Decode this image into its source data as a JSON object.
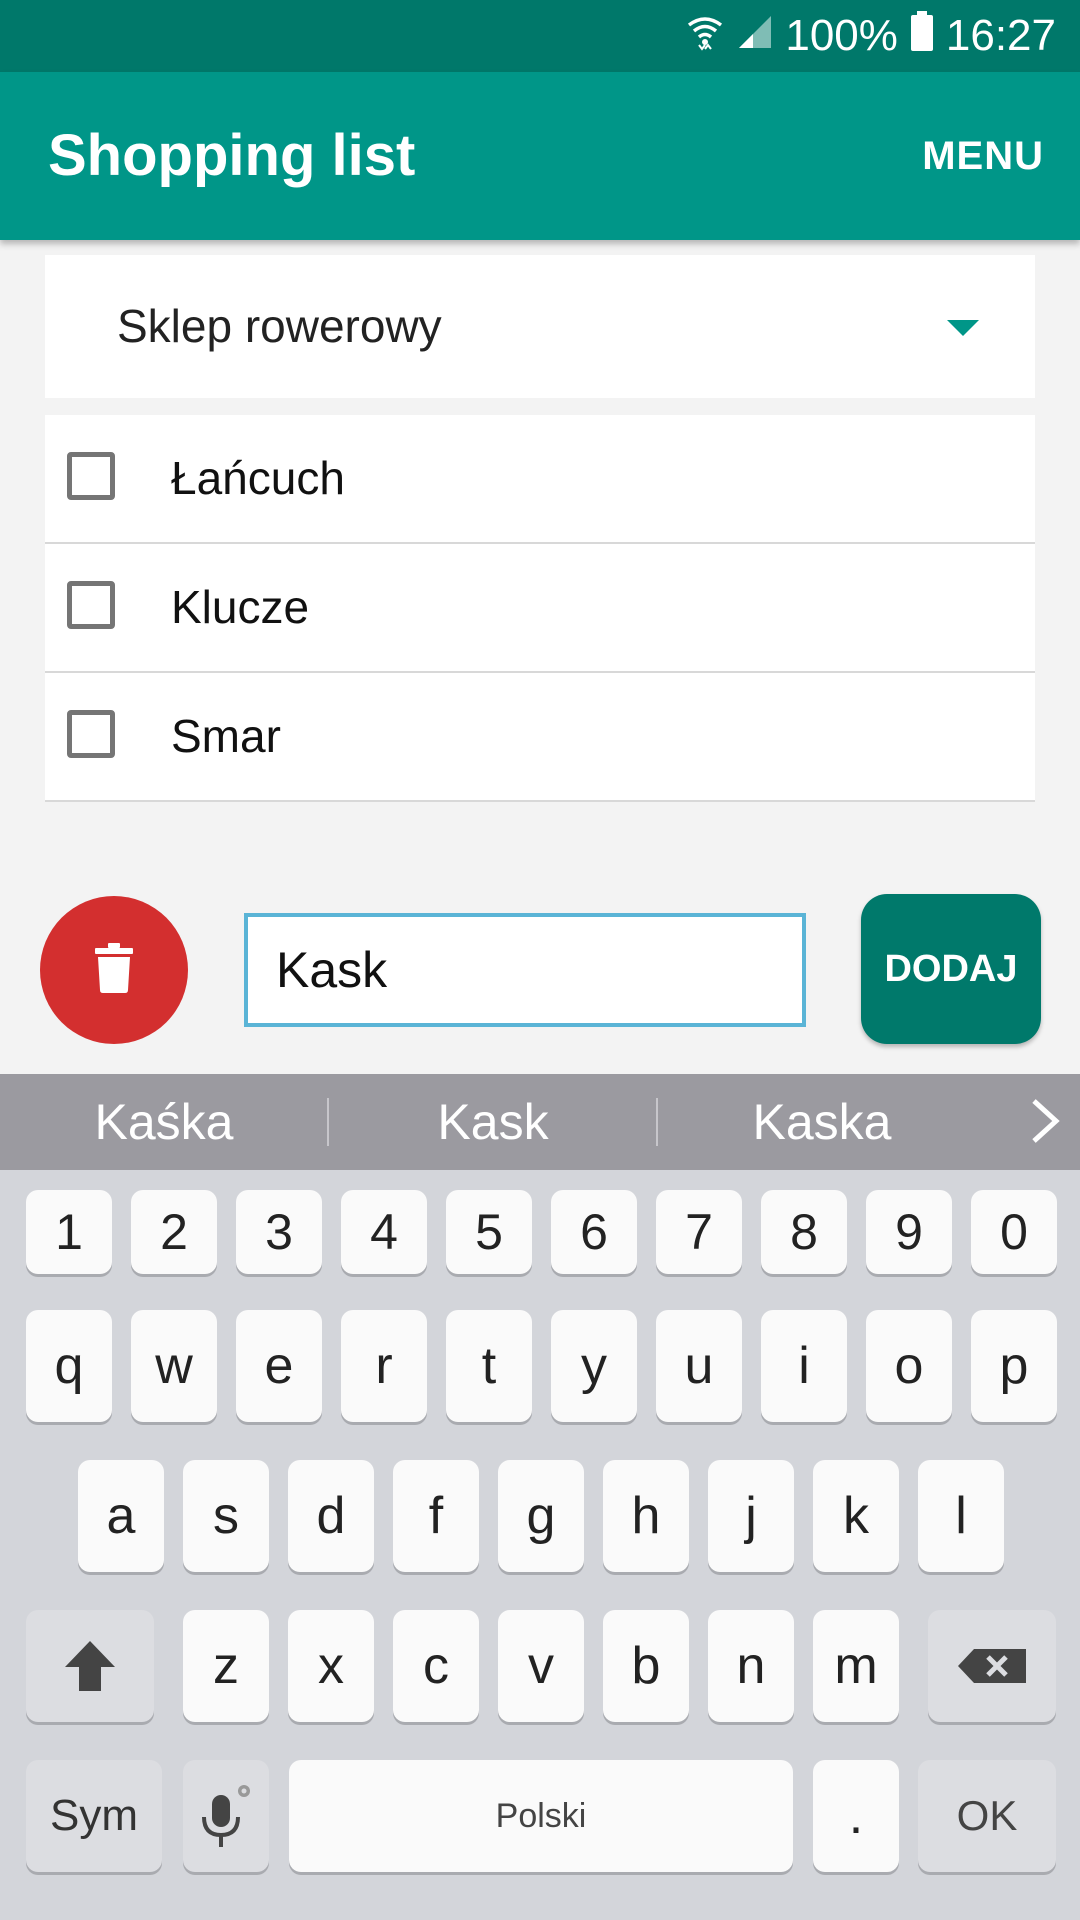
{
  "status_bar": {
    "battery": "100%",
    "time": "16:27",
    "icons": [
      "wifi-icon",
      "signal-icon",
      "battery-icon"
    ]
  },
  "app_bar": {
    "title": "Shopping list",
    "menu_label": "MENU"
  },
  "store_dropdown": {
    "selected": "Sklep rowerowy"
  },
  "items": [
    {
      "label": "Łańcuch",
      "checked": false
    },
    {
      "label": "Klucze",
      "checked": false
    },
    {
      "label": "Smar",
      "checked": false
    }
  ],
  "input": {
    "value": "Kask",
    "add_label": "DODAJ",
    "delete_icon": "trash-icon"
  },
  "keyboard": {
    "suggestions": [
      "Kaśka",
      "Kask",
      "Kaska"
    ],
    "row_numbers": [
      "1",
      "2",
      "3",
      "4",
      "5",
      "6",
      "7",
      "8",
      "9",
      "0"
    ],
    "row1": [
      "q",
      "w",
      "e",
      "r",
      "t",
      "y",
      "u",
      "i",
      "o",
      "p"
    ],
    "row2": [
      "a",
      "s",
      "d",
      "f",
      "g",
      "h",
      "j",
      "k",
      "l"
    ],
    "row3": [
      "z",
      "x",
      "c",
      "v",
      "b",
      "n",
      "m"
    ],
    "sym_label": "Sym",
    "space_label": "Polski",
    "period_label": ".",
    "ok_label": "OK"
  },
  "colors": {
    "status_bar": "#00786a",
    "app_bar": "#009688",
    "delete": "#d32f2f",
    "add_button": "#00796b",
    "input_border": "#5ab4d6"
  }
}
